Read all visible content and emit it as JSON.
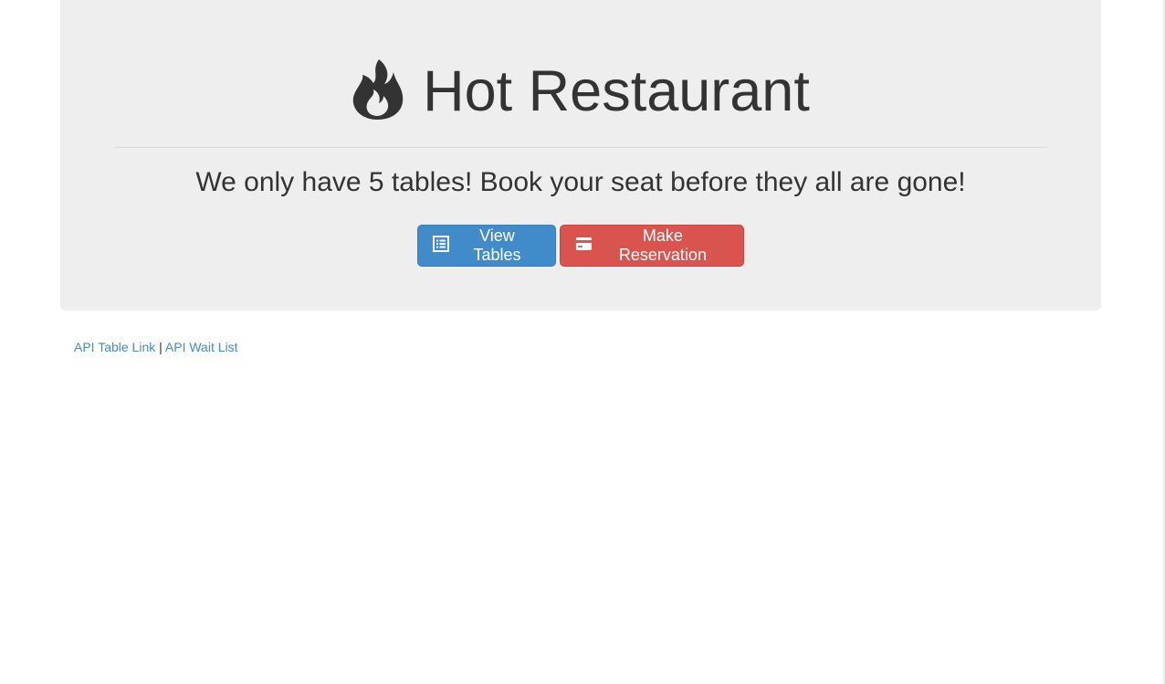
{
  "header": {
    "icon": "fire-icon",
    "title": "Hot Restaurant",
    "tagline": "We only have 5 tables! Book your seat before they all are gone!"
  },
  "actions": {
    "view_tables": {
      "label": "View Tables",
      "icon": "list-alt-icon"
    },
    "make_reservation": {
      "label": "Make Reservation",
      "icon": "credit-card-icon"
    }
  },
  "footer_links": {
    "api_table": "API Table Link",
    "separator": "|",
    "api_wait_list": "API Wait List"
  },
  "colors": {
    "jumbotron_bg": "#eeeeee",
    "primary": "#428bca",
    "danger": "#d9534f",
    "link": "#428bca",
    "text": "#333333"
  }
}
